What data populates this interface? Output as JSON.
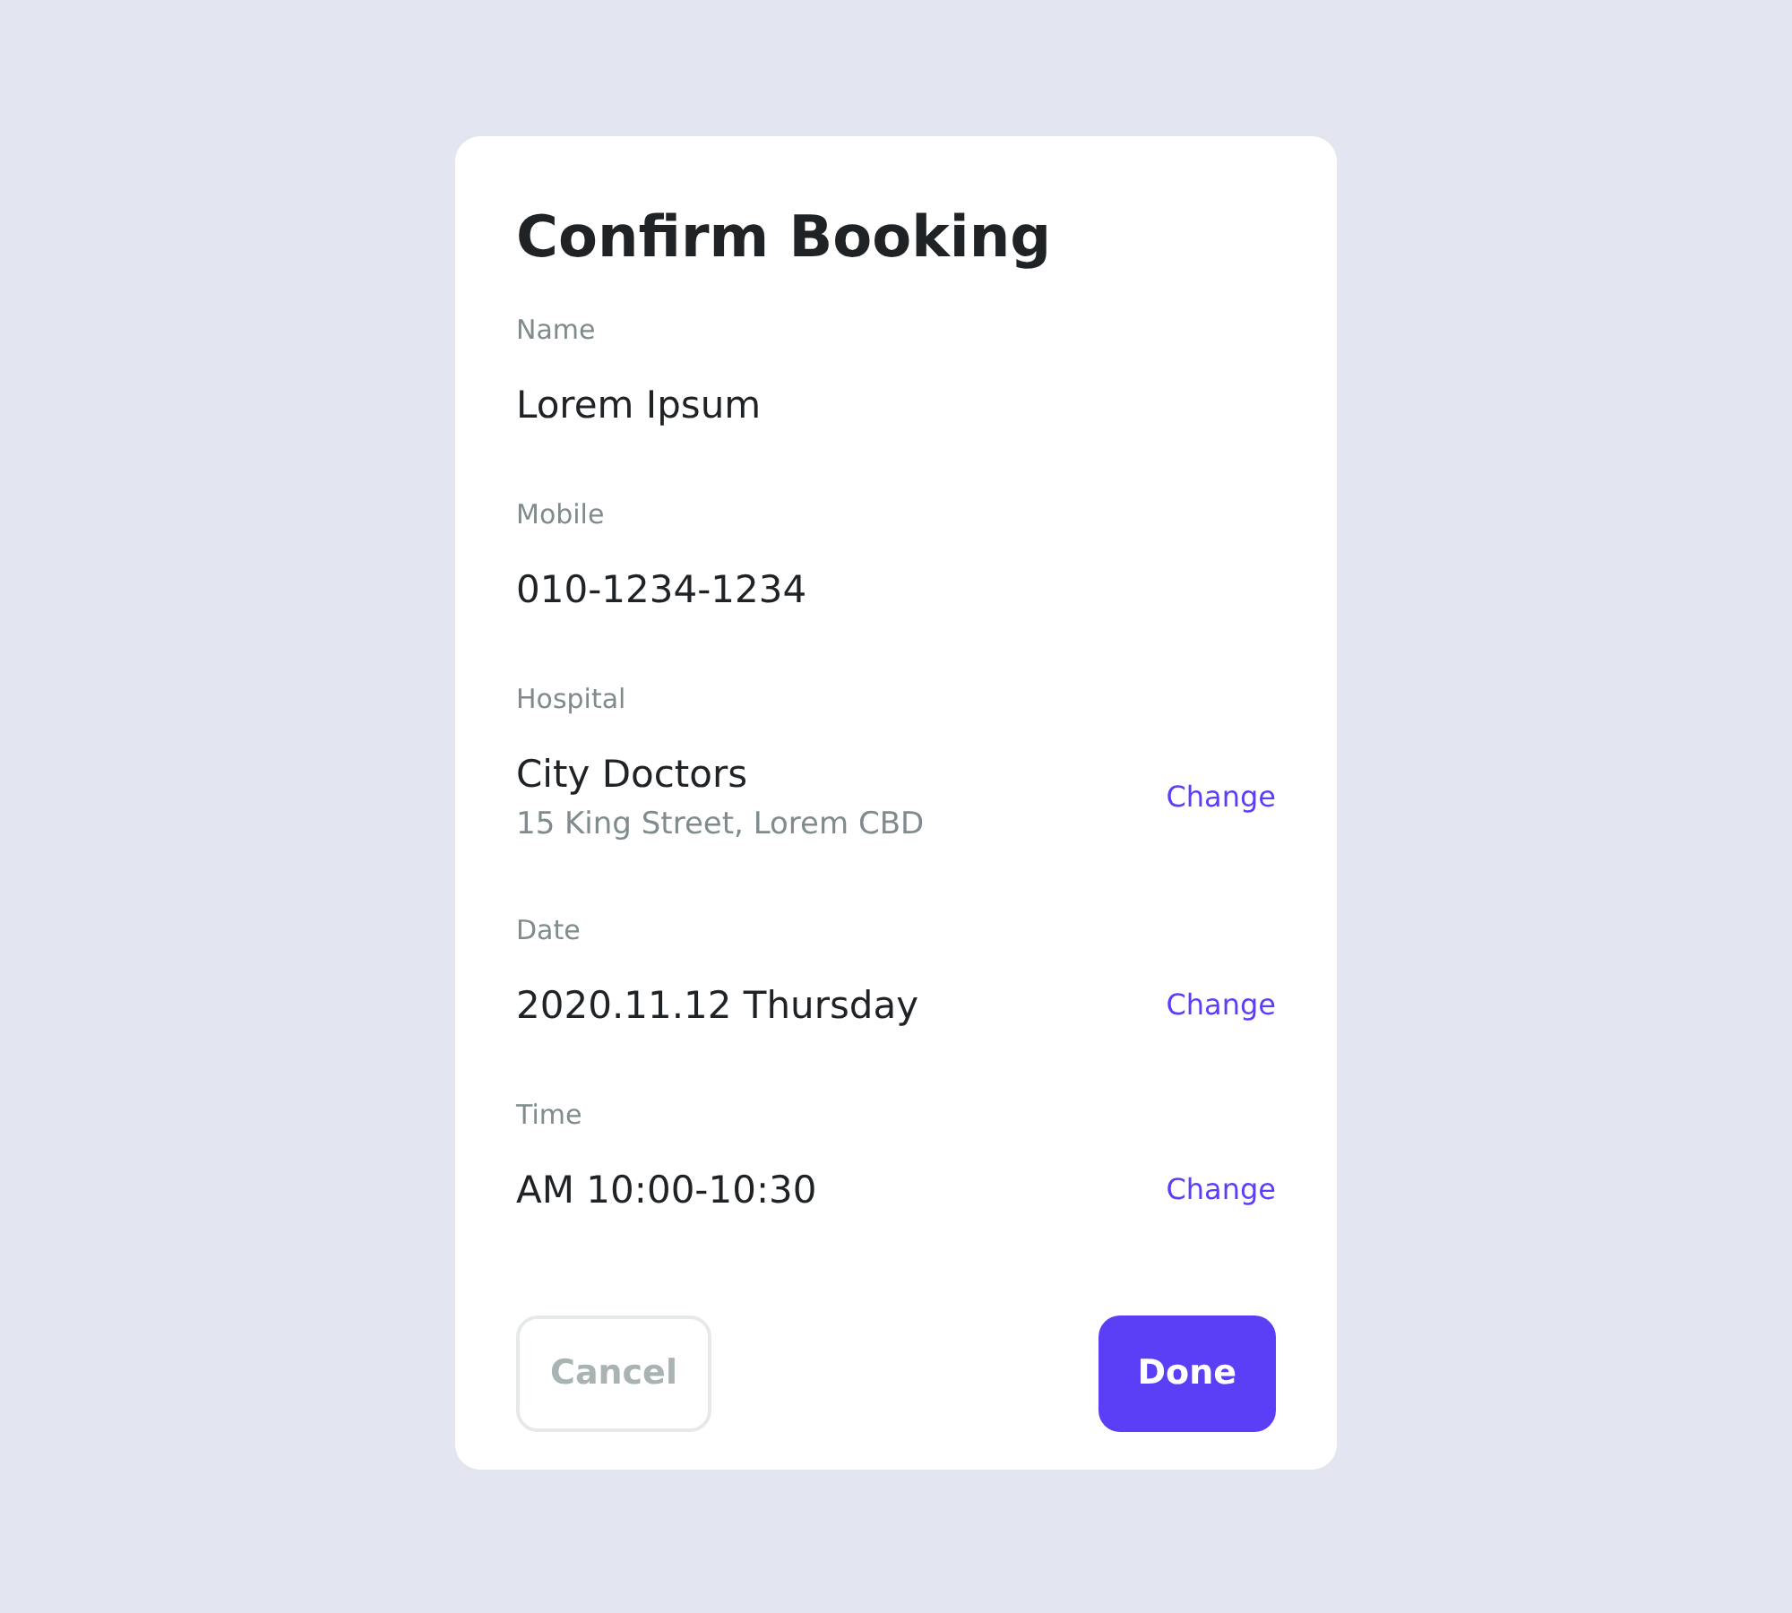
{
  "dialog": {
    "title": "Confirm Booking"
  },
  "fields": [
    {
      "label": "Name",
      "value": "Lorem Ipsum"
    },
    {
      "label": "Mobile",
      "value": "010-1234-1234"
    },
    {
      "label": "Hospital",
      "value": "City Doctors",
      "detail": "15 King Street, Lorem CBD",
      "action": "Change"
    },
    {
      "label": "Date",
      "value": "2020.11.12 Thursday",
      "action": "Change"
    },
    {
      "label": "Time",
      "value": "AM 10:00-10:30",
      "action": "Change"
    }
  ],
  "buttons": [
    {
      "label": "Cancel",
      "kind": "secondary"
    },
    {
      "label": "Done",
      "kind": "primary"
    }
  ]
}
